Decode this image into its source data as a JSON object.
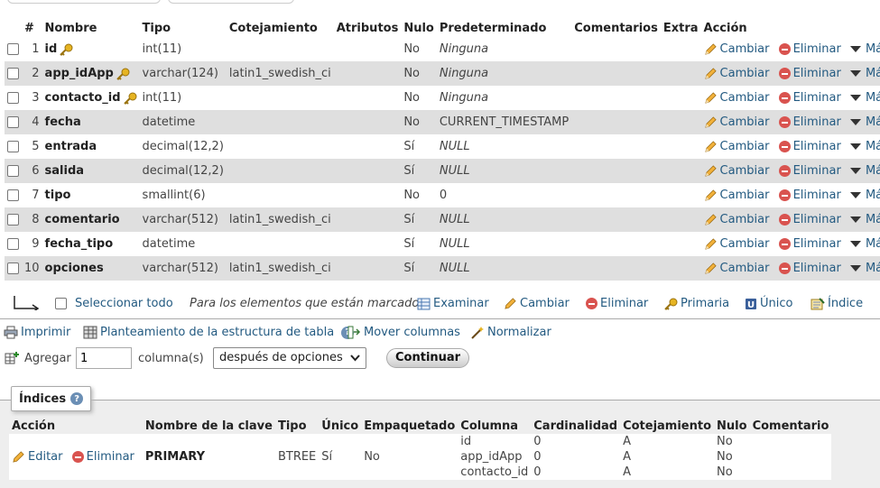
{
  "structure": {
    "headers": [
      "#",
      "Nombre",
      "Tipo",
      "Cotejamiento",
      "Atributos",
      "Nulo",
      "Predeterminado",
      "Comentarios",
      "Extra",
      "Acción"
    ],
    "rows": [
      {
        "num": "1",
        "name": "id",
        "type": "int(11)",
        "collation": "",
        "null": "No",
        "default": "Ninguna",
        "key": true
      },
      {
        "num": "2",
        "name": "app_idApp",
        "type": "varchar(124)",
        "collation": "latin1_swedish_ci",
        "null": "No",
        "default": "Ninguna",
        "key": true
      },
      {
        "num": "3",
        "name": "contacto_id",
        "type": "int(11)",
        "collation": "",
        "null": "No",
        "default": "Ninguna",
        "key": true
      },
      {
        "num": "4",
        "name": "fecha",
        "type": "datetime",
        "collation": "",
        "null": "No",
        "default": "CURRENT_TIMESTAMP",
        "key": false
      },
      {
        "num": "5",
        "name": "entrada",
        "type": "decimal(12,2)",
        "collation": "",
        "null": "Sí",
        "default": "NULL",
        "key": false
      },
      {
        "num": "6",
        "name": "salida",
        "type": "decimal(12,2)",
        "collation": "",
        "null": "Sí",
        "default": "NULL",
        "key": false
      },
      {
        "num": "7",
        "name": "tipo",
        "type": "smallint(6)",
        "collation": "",
        "null": "No",
        "default": "0",
        "key": false
      },
      {
        "num": "8",
        "name": "comentario",
        "type": "varchar(512)",
        "collation": "latin1_swedish_ci",
        "null": "Sí",
        "default": "NULL",
        "key": false
      },
      {
        "num": "9",
        "name": "fecha_tipo",
        "type": "datetime",
        "collation": "",
        "null": "Sí",
        "default": "NULL",
        "key": false
      },
      {
        "num": "10",
        "name": "opciones",
        "type": "varchar(512)",
        "collation": "latin1_swedish_ci",
        "null": "Sí",
        "default": "NULL",
        "key": false
      }
    ],
    "actions": {
      "change": "Cambiar",
      "drop": "Eliminar",
      "more": "Más"
    }
  },
  "bulk": {
    "select_all": "Seleccionar todo",
    "marked": "Para los elementos que están marcados:",
    "browse": "Examinar",
    "change": "Cambiar",
    "drop": "Eliminar",
    "primary": "Primaria",
    "unique": "Único",
    "index": "Índice"
  },
  "tools": {
    "print": "Imprimir",
    "propose": "Planteamiento de la estructura de tabla",
    "move": "Mover columnas",
    "normalize": "Normalizar"
  },
  "add": {
    "label": "Agregar",
    "count": "1",
    "unit": "columna(s)",
    "position": "después de opciones",
    "submit": "Continuar"
  },
  "indexes": {
    "title": "Índices",
    "headers": [
      "Acción",
      "Nombre de la clave",
      "Tipo",
      "Único",
      "Empaquetado",
      "Columna",
      "Cardinalidad",
      "Cotejamiento",
      "Nulo",
      "Comentario"
    ],
    "edit": "Editar",
    "drop": "Eliminar",
    "key_name": "PRIMARY",
    "type": "BTREE",
    "unique": "Sí",
    "packed": "No",
    "columns": [
      "id",
      "app_idApp",
      "contacto_id"
    ],
    "cardinality": [
      "0",
      "0",
      "0"
    ],
    "collation": [
      "A",
      "A",
      "A"
    ],
    "null": [
      "No",
      "No",
      "No"
    ]
  }
}
